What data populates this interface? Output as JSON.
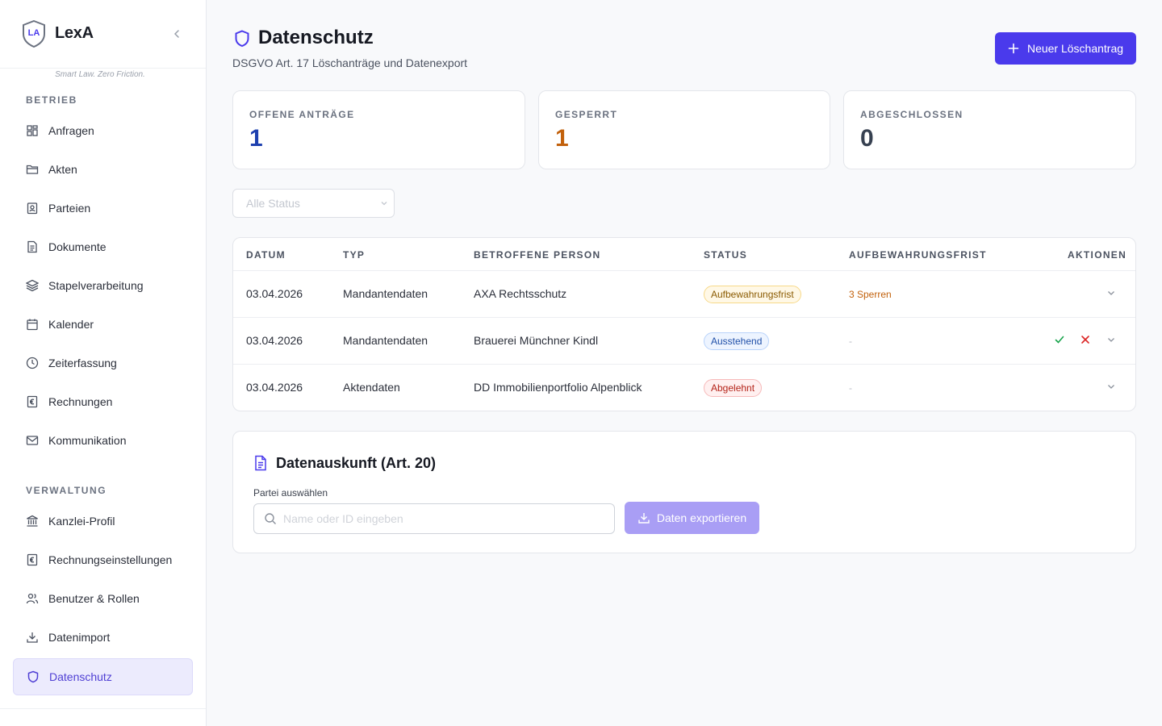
{
  "brand": {
    "name": "LexA",
    "logo_text": "LA",
    "tagline": "Smart Law. Zero Friction."
  },
  "sidebar": {
    "section_betrieb": "BETRIEB",
    "section_verwaltung": "VERWALTUNG",
    "betrieb_items": [
      {
        "label": "Anfragen",
        "icon": "grid-icon"
      },
      {
        "label": "Akten",
        "icon": "folder-icon"
      },
      {
        "label": "Parteien",
        "icon": "contact-icon"
      },
      {
        "label": "Dokumente",
        "icon": "document-icon"
      },
      {
        "label": "Stapelverarbeitung",
        "icon": "layers-icon"
      },
      {
        "label": "Kalender",
        "icon": "calendar-icon"
      },
      {
        "label": "Zeiterfassung",
        "icon": "clock-icon"
      },
      {
        "label": "Rechnungen",
        "icon": "euro-receipt-icon"
      },
      {
        "label": "Kommunikation",
        "icon": "mail-icon"
      }
    ],
    "verwaltung_items": [
      {
        "label": "Kanzlei-Profil",
        "icon": "building-icon"
      },
      {
        "label": "Rechnungseinstellungen",
        "icon": "euro-receipt-icon"
      },
      {
        "label": "Benutzer & Rollen",
        "icon": "users-icon"
      },
      {
        "label": "Datenimport",
        "icon": "download-icon"
      },
      {
        "label": "Datenschutz",
        "icon": "shield-icon",
        "active": true
      }
    ]
  },
  "header": {
    "title": "Datenschutz",
    "subtitle": "DSGVO Art. 17 Löschanträge und Datenexport",
    "new_button": "Neuer Löschantrag"
  },
  "stats": [
    {
      "label": "OFFENE ANTRÄGE",
      "value": "1",
      "color": "#1e40af"
    },
    {
      "label": "GESPERRT",
      "value": "1",
      "color": "#c2610c"
    },
    {
      "label": "ABGESCHLOSSEN",
      "value": "0",
      "color": "#374151"
    }
  ],
  "filter": {
    "selected": "Alle Status"
  },
  "table": {
    "columns": [
      "DATUM",
      "TYP",
      "BETROFFENE PERSON",
      "STATUS",
      "AUFBEWAHRUNGSFRIST",
      "AKTIONEN"
    ],
    "rows": [
      {
        "date": "03.04.2026",
        "type": "Mandantendaten",
        "person": "AXA Rechtsschutz",
        "status": "Aufbewahrungsfrist",
        "status_kind": "warn",
        "frist": "3 Sperren"
      },
      {
        "date": "03.04.2026",
        "type": "Mandantendaten",
        "person": "Brauerei Münchner Kindl",
        "status": "Ausstehend",
        "status_kind": "info",
        "frist": "-"
      },
      {
        "date": "03.04.2026",
        "type": "Aktendaten",
        "person": "DD Immobilienportfolio Alpenblick",
        "status": "Abgelehnt",
        "status_kind": "err",
        "frist": "-"
      }
    ]
  },
  "export": {
    "title": "Datenauskunft (Art. 20)",
    "field_label": "Partei auswählen",
    "placeholder": "Name oder ID eingeben",
    "button": "Daten exportieren"
  },
  "colors": {
    "accent": "#4a3aec",
    "accent_disabled": "#a99ef5",
    "frist_warn": "#c2610c"
  }
}
